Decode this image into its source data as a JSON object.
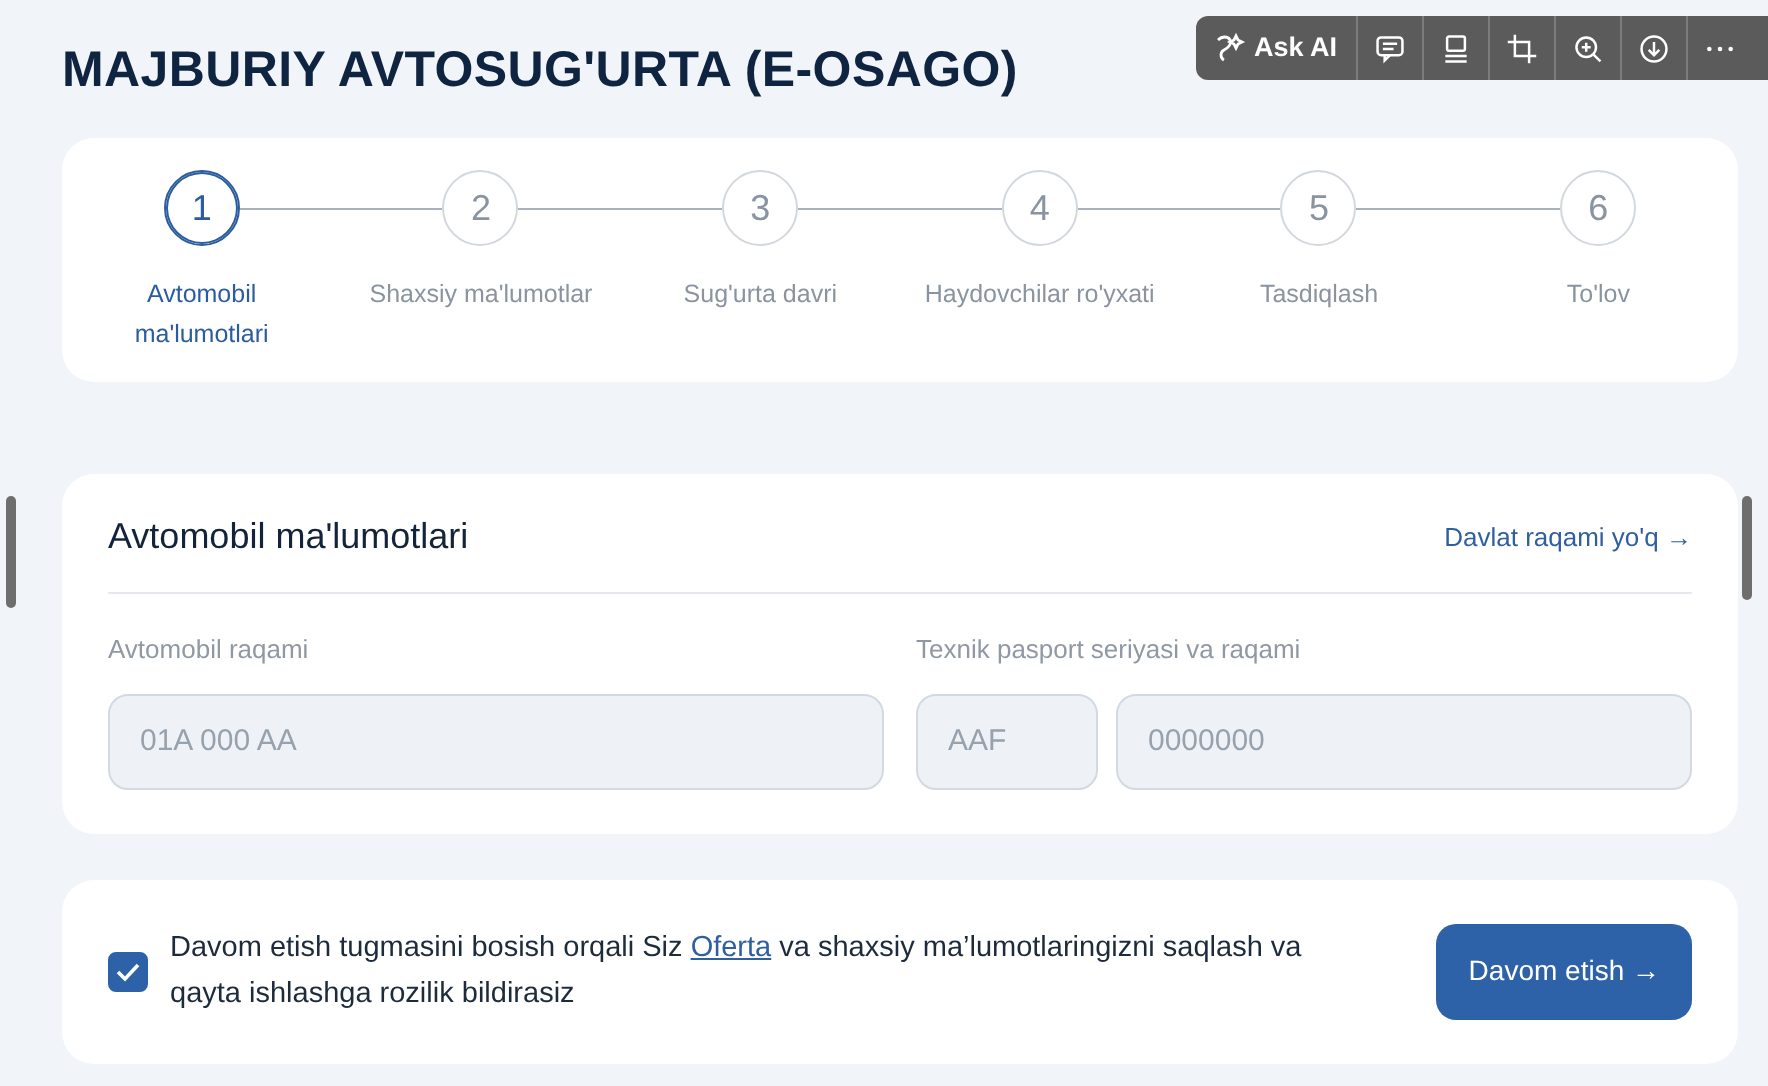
{
  "viewer_toolbar": {
    "ask_ai": "Ask AI"
  },
  "page_title": "MAJBURIY AVTOSUG'URTA (E-OSAGO)",
  "steps": [
    {
      "number": "1",
      "label": "Avtomobil ma'lumotlari",
      "selected": true
    },
    {
      "number": "2",
      "label": "Shaxsiy ma'lumotlar",
      "selected": false
    },
    {
      "number": "3",
      "label": "Sug'urta davri",
      "selected": false
    },
    {
      "number": "4",
      "label": "Haydovchilar ro'yxati",
      "selected": false
    },
    {
      "number": "5",
      "label": "Tasdiqlash",
      "selected": false
    },
    {
      "number": "6",
      "label": "To'lov",
      "selected": false
    }
  ],
  "vehicle_card": {
    "title": "Avtomobil ma'lumotlari",
    "link": "Davlat raqami yo'q →",
    "fields": [
      {
        "label": "Avtomobil raqami",
        "inputs": [
          {
            "placeholder": "01A 000 AA"
          }
        ]
      },
      {
        "label": "Texnik pasport seriyasi va raqami",
        "inputs": [
          {
            "placeholder": "AAF"
          },
          {
            "placeholder": "0000000"
          }
        ]
      }
    ]
  },
  "consent": {
    "checked": true,
    "text_before": "Davom etish tugmasini bosish orqali Siz ",
    "link": "Oferta",
    "text_after": " va shaxsiy ma’lumotlaringizni saqlash va qayta ishlashga rozilik bildirasiz",
    "button": "Davom etish →"
  }
}
